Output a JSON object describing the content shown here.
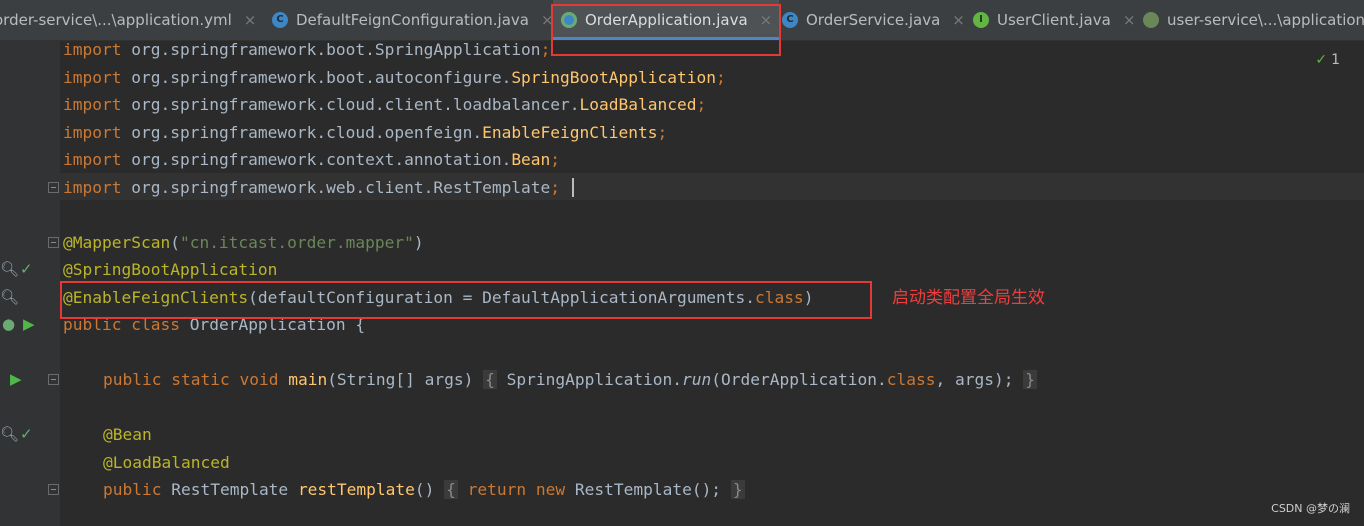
{
  "tabs": [
    {
      "label": "order-service\\...\\application.yml",
      "icon": "yaml-icon",
      "active": false
    },
    {
      "label": "DefaultFeignConfiguration.java",
      "icon": "class-icon",
      "active": false
    },
    {
      "label": "OrderApplication.java",
      "icon": "spring-boot-class-icon",
      "active": true
    },
    {
      "label": "OrderService.java",
      "icon": "class-icon",
      "active": false
    },
    {
      "label": "UserClient.java",
      "icon": "interface-icon",
      "active": false
    },
    {
      "label": "user-service\\...\\application.yml",
      "icon": "yaml-icon",
      "active": false
    }
  ],
  "inspection": {
    "count": "1"
  },
  "code": {
    "l1": {
      "kw": "import",
      "pkg": " org.springframework.boot.",
      "cls": "SpringApplication",
      "end": ";"
    },
    "l2": {
      "kw": "import",
      "pkg": " org.springframework.boot.autoconfigure.",
      "cls": "SpringBootApplication",
      "end": ";"
    },
    "l3": {
      "kw": "import",
      "pkg": " org.springframework.cloud.client.loadbalancer.",
      "cls": "LoadBalanced",
      "end": ";"
    },
    "l4": {
      "kw": "import",
      "pkg": " org.springframework.cloud.openfeign.",
      "cls": "EnableFeignClients",
      "end": ";"
    },
    "l5": {
      "kw": "import",
      "pkg": " org.springframework.context.annotation.",
      "cls": "Bean",
      "end": ";"
    },
    "l6": {
      "kw": "import",
      "pkg": " org.springframework.web.client.RestTemplate",
      "end": ";"
    },
    "l7": {
      "ann": "@MapperScan",
      "open": "(",
      "str": "\"cn.itcast.order.mapper\"",
      "close": ")"
    },
    "l8": {
      "ann": "@SpringBootApplication"
    },
    "l9": {
      "ann": "@EnableFeignClients",
      "rest": "(defaultConfiguration = DefaultApplicationArguments.",
      "kwclass": "class",
      "close": ")"
    },
    "l10": {
      "kw1": "public",
      "kw2": "class",
      "rest": " OrderApplication {"
    },
    "l11": {
      "kw1": "public",
      "kw2": "static",
      "kw3": "void",
      "fn": "main",
      "params": "(String[] args) ",
      "brace_open": "{",
      "body1": " SpringApplication.",
      "run": "run",
      "body2": "(OrderApplication.",
      "kwclass": "class",
      "body3": ", args);",
      "brace_close": "}"
    },
    "l12": {
      "ann": "@Bean"
    },
    "l13": {
      "ann": "@LoadBalanced"
    },
    "l14": {
      "kw1": "public",
      "type": " RestTemplate ",
      "fn": "restTemplate",
      "params": "() ",
      "brace_open": "{",
      "kwret": "return",
      "kwnew": "new",
      "body": " RestTemplate();",
      "brace_close": "}"
    }
  },
  "annotation_note": "启动类配置全局生效",
  "watermark": "CSDN @梦の澜",
  "colors": {
    "highlight_box": "#e53935",
    "keyword": "#cc7832",
    "annotation": "#bbb529",
    "string": "#6a8759",
    "method": "#ffc66d"
  }
}
